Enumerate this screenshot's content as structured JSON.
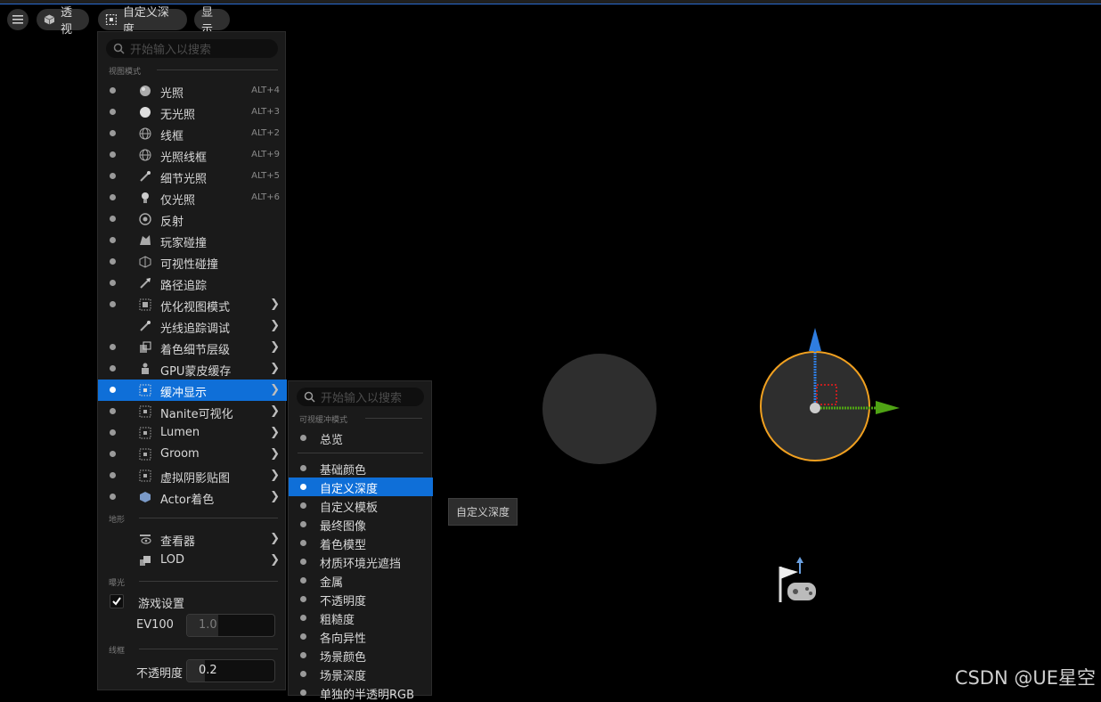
{
  "toolbar": {
    "perspective_label": "透视",
    "view_mode_label": "自定义深度",
    "show_label": "显示"
  },
  "menu": {
    "search_placeholder": "开始输入以搜索",
    "section_view_modes": "视图模式",
    "items": [
      {
        "label": "光照",
        "shortcut": "ALT+4",
        "icon": "sphere-lit-icon"
      },
      {
        "label": "无光照",
        "shortcut": "ALT+3",
        "icon": "sphere-unlit-icon"
      },
      {
        "label": "线框",
        "shortcut": "ALT+2",
        "icon": "wireframe-icon"
      },
      {
        "label": "光照线框",
        "shortcut": "ALT+9",
        "icon": "lit-wireframe-icon"
      },
      {
        "label": "细节光照",
        "shortcut": "ALT+5",
        "icon": "detail-lighting-icon"
      },
      {
        "label": "仅光照",
        "shortcut": "ALT+6",
        "icon": "lightbulb-icon"
      },
      {
        "label": "反射",
        "shortcut": "",
        "icon": "reflection-icon"
      },
      {
        "label": "玩家碰撞",
        "shortcut": "",
        "icon": "player-collision-icon"
      },
      {
        "label": "可视性碰撞",
        "shortcut": "",
        "icon": "visibility-collision-icon"
      },
      {
        "label": "路径追踪",
        "shortcut": "",
        "icon": "path-tracing-icon"
      },
      {
        "label": "优化视图模式",
        "shortcut": "",
        "icon": "optimize-grid-icon"
      },
      {
        "label": "光线追踪调试",
        "shortcut": "",
        "icon": "ray-trace-debug-icon"
      },
      {
        "label": "着色细节层级",
        "shortcut": "",
        "icon": "shading-lod-icon"
      },
      {
        "label": "GPU蒙皮缓存",
        "shortcut": "",
        "icon": "gpu-skin-icon"
      },
      {
        "label": "缓冲显示",
        "shortcut": "",
        "icon": "buffer-icon"
      },
      {
        "label": "Nanite可视化",
        "shortcut": "",
        "icon": "nanite-icon"
      },
      {
        "label": "Lumen",
        "shortcut": "",
        "icon": "lumen-icon"
      },
      {
        "label": "Groom",
        "shortcut": "",
        "icon": "groom-icon"
      },
      {
        "label": "虚拟阴影贴图",
        "shortcut": "",
        "icon": "virtual-shadow-icon"
      },
      {
        "label": "Actor着色",
        "shortcut": "",
        "icon": "actor-color-icon"
      }
    ],
    "section_landscape": "地形",
    "landscape_items": [
      {
        "label": "查看器",
        "icon": "viewer-icon"
      },
      {
        "label": "LOD",
        "icon": "lod-icon"
      }
    ],
    "section_exposure": "曝光",
    "game_settings_label": "游戏设置",
    "ev100_label": "EV100",
    "ev100_value": "1.0",
    "section_wireframe": "线框",
    "opacity_label": "不透明度",
    "opacity_value": "0.2"
  },
  "submenu": {
    "search_placeholder": "开始输入以搜索",
    "section_title": "可视缓冲模式",
    "overview_label": "总览",
    "items": [
      "基础颜色",
      "自定义深度",
      "自定义模板",
      "最终图像",
      "着色模型",
      "材质环境光遮挡",
      "金属",
      "不透明度",
      "粗糙度",
      "各向异性",
      "场景颜色",
      "场景深度",
      "单独的半透明RGB"
    ]
  },
  "tooltip_text": "自定义深度",
  "watermark": "CSDN @UE星空"
}
